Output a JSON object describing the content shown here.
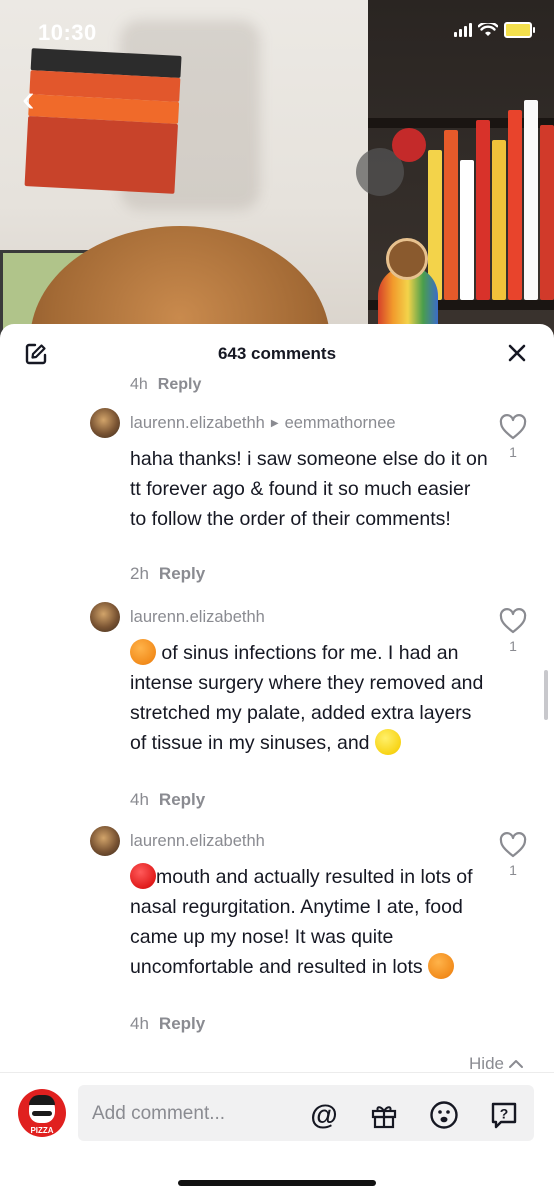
{
  "status_bar": {
    "time": "10:30"
  },
  "sheet": {
    "title": "643 comments"
  },
  "cut_row": {
    "time": "4h",
    "reply_label": "Reply"
  },
  "comments": [
    {
      "username": "laurenn.elizabethh",
      "reply_to": "eemmathornee",
      "text": "haha thanks! i saw someone else do it on tt forever ago & found it so much easier to follow the order of their comments!",
      "time": "2h",
      "reply_label": "Reply",
      "likes": "1"
    },
    {
      "username": "laurenn.elizabethh",
      "text_a": " of sinus infections for me. I had an intense surgery where they removed and stretched my palate, added extra layers of tissue in my sinuses, and ",
      "emoji_lead": "orange-circle-emoji",
      "emoji_trail": "yellow-circle-emoji",
      "time": "4h",
      "reply_label": "Reply",
      "likes": "1"
    },
    {
      "username": "laurenn.elizabethh",
      "text_a": "mouth and actually resulted in lots of nasal regurgitation. Anytime I ate, food came up my nose! It was quite uncomfortable and resulted in lots ",
      "emoji_lead": "red-circle-emoji",
      "emoji_trail": "orange-circle-emoji",
      "time": "4h",
      "reply_label": "Reply",
      "likes": "1"
    }
  ],
  "hide_label": "Hide",
  "input": {
    "placeholder": "Add comment...",
    "user_avatar_text": "PIZZA"
  },
  "icons": [
    "edit-icon",
    "close-icon",
    "heart-icon",
    "at-icon",
    "gift-icon",
    "emoji-icon",
    "question-icon",
    "chevron-up-icon",
    "back-icon"
  ],
  "colors": {
    "text_primary": "#161823",
    "text_secondary": "#8a8b91",
    "avatar_red": "#e0201f"
  }
}
